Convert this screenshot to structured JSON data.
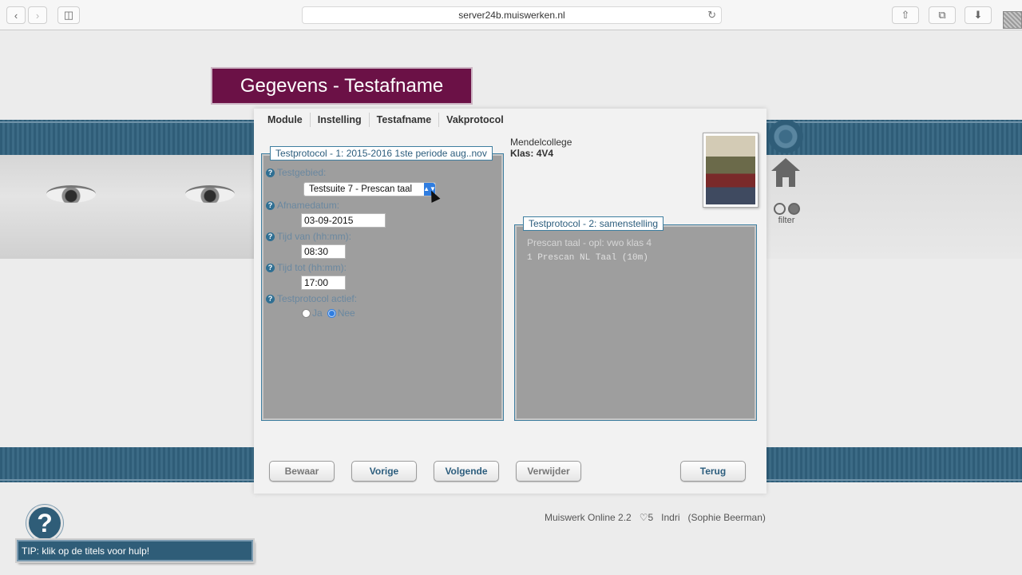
{
  "browser": {
    "url": "server24b.muiswerken.nl"
  },
  "page": {
    "title": "Gegevens - Testafname"
  },
  "tabs": [
    {
      "label": "Module"
    },
    {
      "label": "Instelling"
    },
    {
      "label": "Testafname"
    },
    {
      "label": "Vakprotocol"
    }
  ],
  "protocol1": {
    "legend": "Testprotocol - 1: 2015-2016 1ste periode aug..nov",
    "fields": {
      "testgebied_label": "Testgebied:",
      "testgebied_value": "Testsuite 7 - Prescan taal",
      "afnamedatum_label": "Afnamedatum:",
      "afnamedatum_value": "03-09-2015",
      "tijd_van_label": "Tijd van (hh:mm):",
      "tijd_van_value": "08:30",
      "tijd_tot_label": "Tijd tot (hh:mm):",
      "tijd_tot_value": "17:00",
      "actief_label": "Testprotocol actief:",
      "ja_label": "Ja",
      "nee_label": "Nee"
    }
  },
  "school": {
    "name": "Mendelcollege",
    "klas_label": "Klas:",
    "klas_value": "4V4"
  },
  "protocol2": {
    "legend": "Testprotocol - 2: samenstelling",
    "heading": "Prescan taal - opl: vwo klas 4",
    "item": "1 Prescan NL Taal (10m)"
  },
  "side": {
    "filter_label": "filter"
  },
  "buttons": {
    "bewaar": "Bewaar",
    "vorige": "Vorige",
    "volgende": "Volgende",
    "verwijder": "Verwijder",
    "terug": "Terug"
  },
  "footer": {
    "app_version": "Muiswerk Online 2.2",
    "likes": "♡5",
    "user": "Indri",
    "user_name": "(Sophie Beerman)"
  },
  "help": {
    "symbol": "?",
    "tip": "TIP: klik op de titels voor hulp!"
  },
  "icons": {
    "back": "chevron-left-icon",
    "forward": "chevron-right-icon",
    "sidebar": "sidebar-icon",
    "reload": "reload-icon",
    "share": "share-icon",
    "tabs": "tabs-icon",
    "download": "download-icon"
  },
  "colors": {
    "title_bg": "#6b1146",
    "band": "#2f5d78",
    "group_border": "#3e7ea0"
  }
}
